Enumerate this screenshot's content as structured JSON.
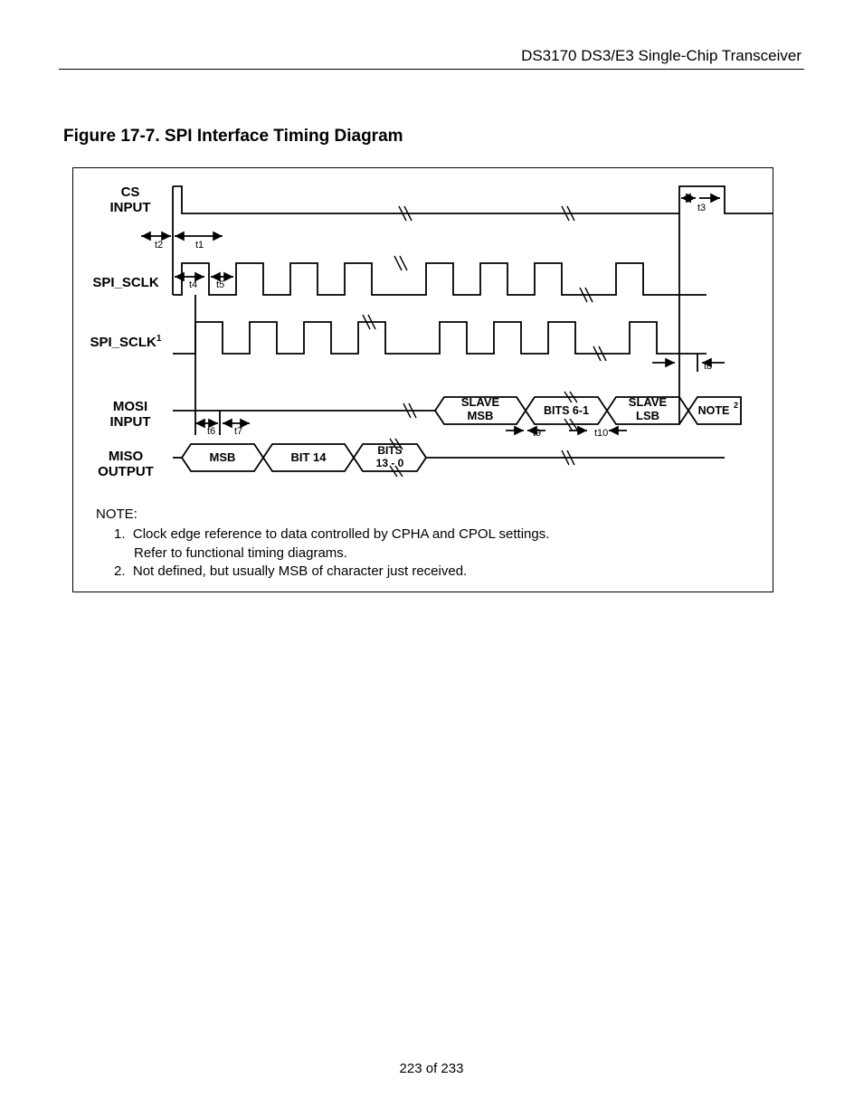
{
  "header": {
    "title": "DS3170 DS3/E3 Single-Chip Transceiver"
  },
  "figure": {
    "caption": "Figure 17-7. SPI Interface Timing Diagram"
  },
  "signals": {
    "cs": {
      "line1": "CS",
      "line2": "INPUT"
    },
    "sclk": {
      "line1": "SPI_SCLK"
    },
    "sclk1": {
      "line1": "SPI_SCLK",
      "sup": "1"
    },
    "mosi": {
      "line1": "MOSI",
      "line2": "INPUT"
    },
    "miso": {
      "line1": "MISO",
      "line2": "OUTPUT"
    }
  },
  "boxes": {
    "mosi": {
      "b0": "SLAVE",
      "b0b": "MSB",
      "b1": "BITS 6-1",
      "b2": "SLAVE",
      "b2b": "LSB",
      "b3": "NOTE",
      "b3sup": "2"
    },
    "miso": {
      "b0": "MSB",
      "b1": "BIT 14",
      "b2a": "BITS",
      "b2b": "13 - 0"
    }
  },
  "tlabels": {
    "t1": "t1",
    "t2": "t2",
    "t3": "t3",
    "t4": "t4",
    "t5": "t5",
    "t6": "t6",
    "t7": "t7",
    "t8": "t8",
    "t9": "t9",
    "t10": "t10"
  },
  "notes": {
    "header": "NOTE:",
    "n1_num": "1.",
    "n1a": "Clock edge reference to data controlled by CPHA and CPOL settings.",
    "n1b": "Refer to functional timing diagrams.",
    "n2_num": "2.",
    "n2": "Not defined, but usually MSB of character just received."
  },
  "footer": {
    "page": "223 of 233"
  }
}
